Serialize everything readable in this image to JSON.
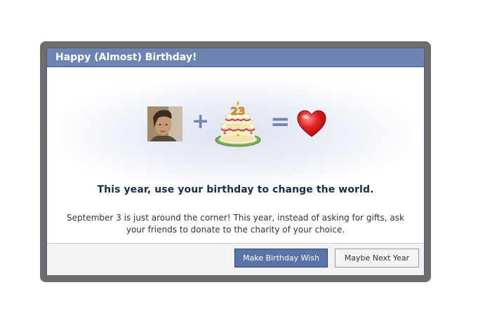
{
  "dialog": {
    "title": "Happy (Almost) Birthday!",
    "tagline": "This year, use your birthday to change the world.",
    "message": "September 3 is just around the corner! This year, instead of asking for gifts, ask your friends to donate to the charity of your choice.",
    "cake_number": "23"
  },
  "equation": {
    "plus_symbol": "+",
    "equals_symbol": "=",
    "icons": [
      "profile-photo",
      "birthday-cake-icon",
      "heart-icon"
    ]
  },
  "buttons": {
    "primary_label": "Make Birthday Wish",
    "secondary_label": "Maybe Next Year"
  },
  "colors": {
    "titlebar": "#6d84b4",
    "primary_button": "#5b74a8",
    "frame": "#6d6d6d",
    "heart": "#d41c1c",
    "tagline": "#1c2a47"
  }
}
